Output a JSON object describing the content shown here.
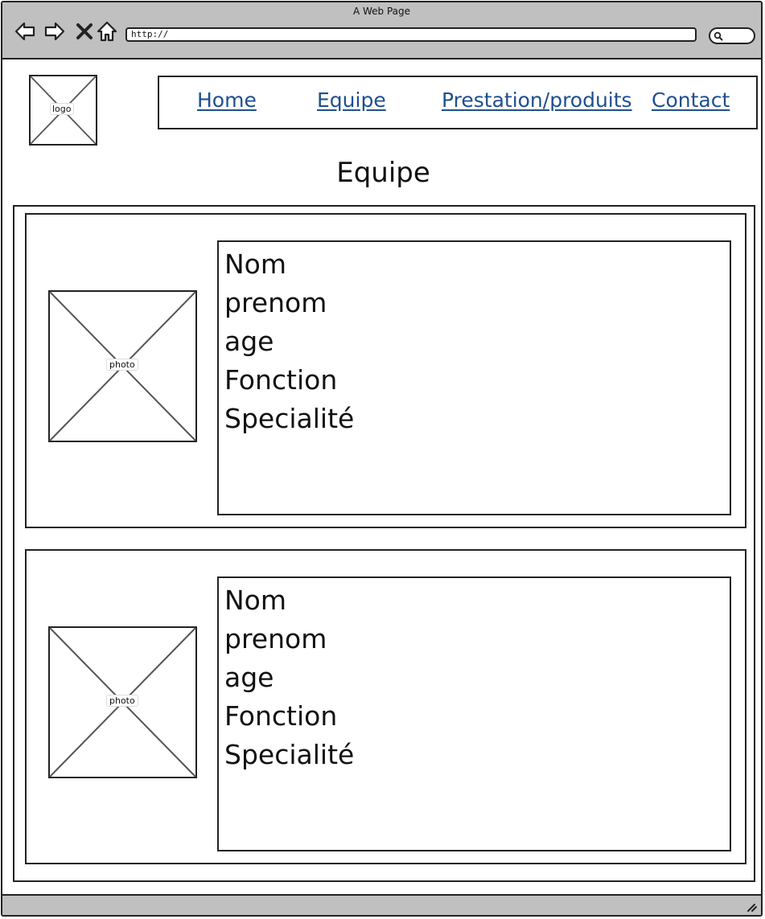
{
  "browser": {
    "title": "A Web Page",
    "url": "http://"
  },
  "logo": {
    "label": "logo"
  },
  "nav": {
    "items": [
      {
        "label": "Home"
      },
      {
        "label": "Equipe"
      },
      {
        "label": "Prestation/produits"
      },
      {
        "label": "Contact"
      }
    ]
  },
  "page": {
    "title": "Equipe"
  },
  "team": [
    {
      "photo_label": "photo",
      "fields": [
        "Nom",
        "prenom",
        "age",
        "Fonction",
        "Specialité"
      ]
    },
    {
      "photo_label": "photo",
      "fields": [
        "Nom",
        "prenom",
        "age",
        "Fonction",
        "Specialité"
      ]
    }
  ],
  "colors": {
    "chrome": "#c0c0c0",
    "link": "#1f4f8f",
    "border": "#222222"
  }
}
